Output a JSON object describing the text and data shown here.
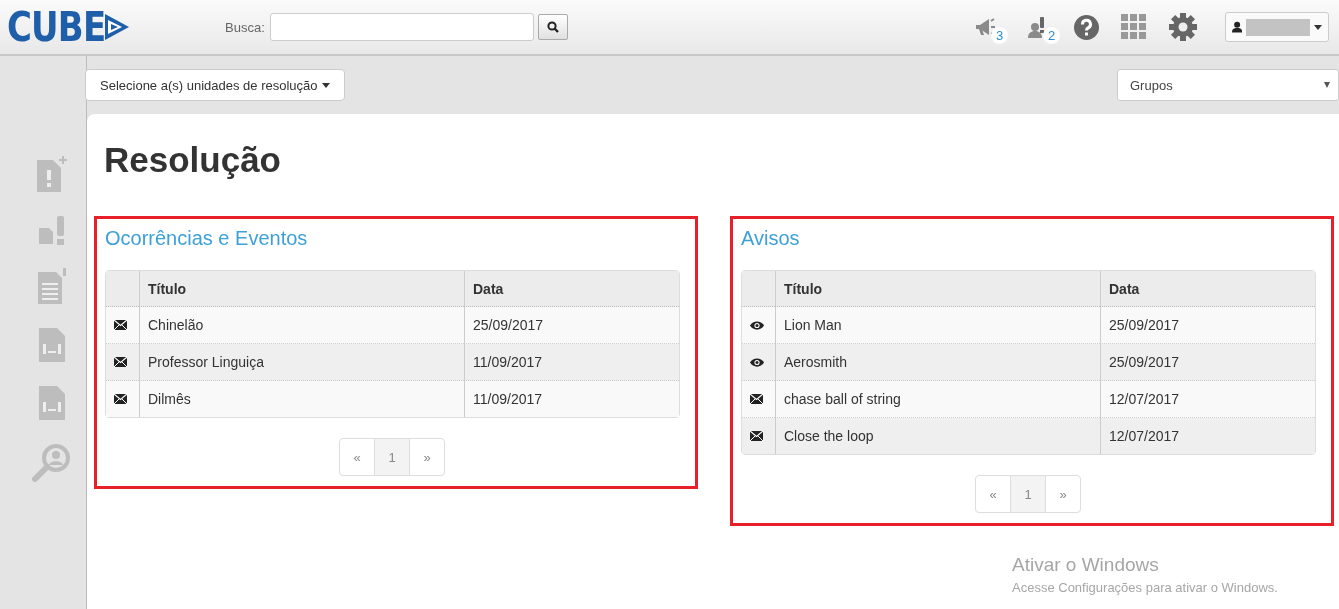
{
  "header": {
    "logo": "CUBE",
    "search": {
      "label": "Busca:"
    },
    "notifications": [
      {
        "kind": "megaphone",
        "count": "3"
      },
      {
        "kind": "alert",
        "count": "2"
      }
    ],
    "user": {
      "name_hidden": true
    }
  },
  "toolbar": {
    "units_button": "Selecione a(s) unidades de resolução",
    "groups_select": "Grupos"
  },
  "sidebar": {
    "items": [
      {
        "kind": "new"
      },
      {
        "kind": "small"
      },
      {
        "kind": "list"
      },
      {
        "kind": "swap"
      },
      {
        "kind": "swap"
      },
      {
        "kind": "search"
      }
    ]
  },
  "page": {
    "title": "Resolução"
  },
  "sections": [
    {
      "title": "Ocorrências e Eventos",
      "highlighted": true,
      "columns": [
        "Título",
        "Data"
      ],
      "rows": [
        {
          "kind": "message",
          "cells": [
            "Chinelão",
            "25/09/2017"
          ]
        },
        {
          "kind": "message",
          "cells": [
            "Professor Linguiça",
            "11/09/2017"
          ]
        },
        {
          "kind": "message",
          "cells": [
            "Dilmês",
            "11/09/2017"
          ]
        }
      ],
      "pagination": {
        "prev": "«",
        "pages": [
          {
            "label": "1",
            "selected": true
          }
        ],
        "next": "»"
      }
    },
    {
      "title": "Avisos",
      "highlighted": true,
      "columns": [
        "Título",
        "Data"
      ],
      "rows": [
        {
          "kind": "viewed",
          "cells": [
            "Lion Man",
            "25/09/2017"
          ]
        },
        {
          "kind": "viewed",
          "cells": [
            "Aerosmith",
            "25/09/2017"
          ]
        },
        {
          "kind": "message",
          "cells": [
            "chase ball of string",
            "12/07/2017"
          ]
        },
        {
          "kind": "message",
          "cells": [
            "Close the loop",
            "12/07/2017"
          ]
        }
      ],
      "pagination": {
        "prev": "«",
        "pages": [
          {
            "label": "1",
            "selected": true
          }
        ],
        "next": "»"
      }
    }
  ],
  "os_notice": {
    "title": "Ativar o Windows",
    "text": "Acesse Configurações para ativar o Windows."
  }
}
